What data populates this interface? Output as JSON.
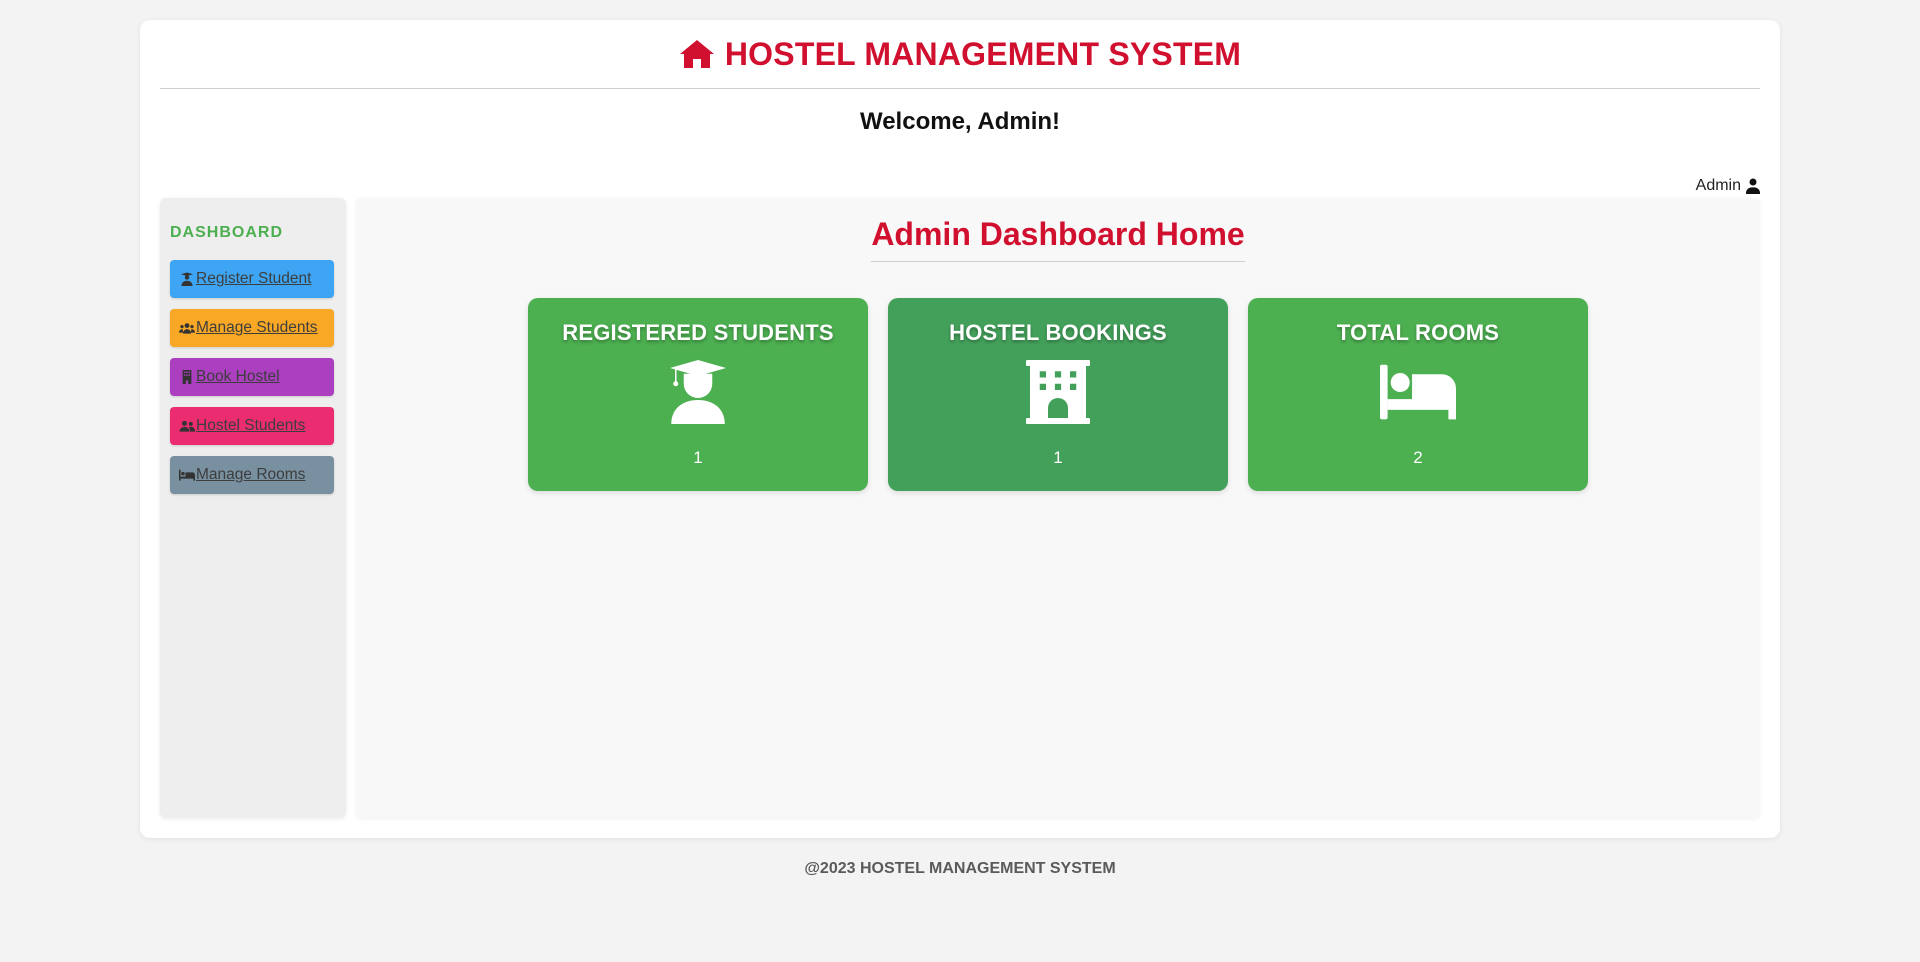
{
  "header": {
    "title": "HOSTEL MANAGEMENT SYSTEM",
    "icon": "home-icon",
    "color": "#d0102e"
  },
  "welcome": "Welcome, Admin!",
  "user": {
    "label": "Admin",
    "icon": "user-icon"
  },
  "sidebar": {
    "title": "DASHBOARD",
    "items": [
      {
        "label": "Register Student",
        "icon": "user-graduate-icon",
        "color": "#3ea5f4"
      },
      {
        "label": "Manage Students",
        "icon": "users-icon",
        "color": "#f9a825"
      },
      {
        "label": "Book Hostel",
        "icon": "building-icon",
        "color": "#ab3fc0"
      },
      {
        "label": "Hostel Students",
        "icon": "user-group-icon",
        "color": "#eb2c70"
      },
      {
        "label": "Manage Rooms",
        "icon": "bed-icon",
        "color": "#7890a0"
      }
    ]
  },
  "main": {
    "title": "Admin Dashboard Home",
    "cards": [
      {
        "title": "REGISTERED STUDENTS",
        "icon": "user-graduate-icon",
        "value": "1"
      },
      {
        "title": "HOSTEL BOOKINGS",
        "icon": "hotel-icon",
        "value": "1"
      },
      {
        "title": "TOTAL ROOMS",
        "icon": "bed-icon",
        "value": "2"
      }
    ]
  },
  "footer": "@2023 HOSTEL MANAGEMENT SYSTEM"
}
